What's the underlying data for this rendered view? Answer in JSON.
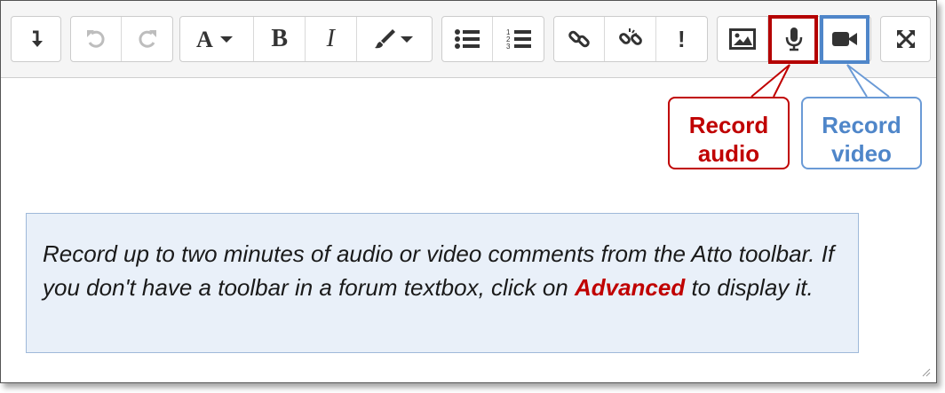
{
  "toolbar": {
    "groups": [
      {
        "id": "collapse",
        "buttons": [
          {
            "name": "collapse-button",
            "icon": "collapse-arrow-icon"
          }
        ]
      },
      {
        "id": "history",
        "buttons": [
          {
            "name": "undo-button",
            "icon": "undo-icon",
            "disabled": true
          },
          {
            "name": "redo-button",
            "icon": "redo-icon",
            "disabled": true
          }
        ]
      },
      {
        "id": "style",
        "buttons": [
          {
            "name": "paragraph-styles-button",
            "icon": "font-a-dropdown-icon"
          },
          {
            "name": "bold-button",
            "icon": "bold-icon",
            "label": "B"
          },
          {
            "name": "italic-button",
            "icon": "italic-icon",
            "label": "I"
          },
          {
            "name": "text-color-button",
            "icon": "paintbrush-dropdown-icon"
          }
        ]
      },
      {
        "id": "lists",
        "buttons": [
          {
            "name": "unordered-list-button",
            "icon": "bullet-list-icon"
          },
          {
            "name": "ordered-list-button",
            "icon": "numbered-list-icon"
          }
        ]
      },
      {
        "id": "links",
        "buttons": [
          {
            "name": "link-button",
            "icon": "link-icon"
          },
          {
            "name": "unlink-button",
            "icon": "unlink-icon"
          },
          {
            "name": "accessibility-checker-button",
            "icon": "exclamation-icon",
            "label": "!"
          }
        ]
      },
      {
        "id": "media",
        "buttons": [
          {
            "name": "insert-image-button",
            "icon": "image-icon"
          },
          {
            "name": "record-audio-button",
            "icon": "microphone-icon"
          },
          {
            "name": "record-video-button",
            "icon": "video-camera-icon"
          }
        ]
      },
      {
        "id": "fullscreen",
        "buttons": [
          {
            "name": "fullscreen-button",
            "icon": "expand-arrows-icon"
          }
        ]
      }
    ]
  },
  "callouts": {
    "audio": {
      "line1": "Record",
      "line2": "audio",
      "color": "#c00000"
    },
    "video": {
      "line1": "Record",
      "line2": "video",
      "color": "#4f86c9"
    }
  },
  "note": {
    "text_before": "Record up to two minutes of audio or video comments from the Atto toolbar. If you don't have a toolbar in a forum textbox, click on ",
    "emphasis": "Advanced",
    "text_after": " to display it.",
    "background": "#e9f0f9"
  },
  "labels": {
    "bold": "B",
    "italic": "I",
    "exclamation": "!"
  }
}
